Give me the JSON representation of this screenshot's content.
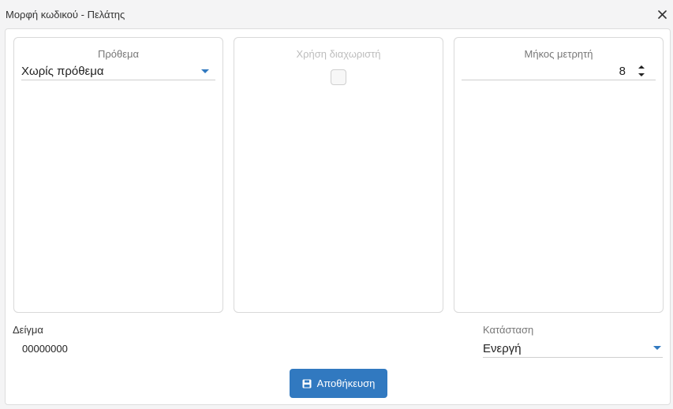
{
  "window": {
    "title": "Μορφή κωδικού - Πελάτης",
    "close_icon": "close-icon"
  },
  "prefix": {
    "label": "Πρόθεμα",
    "value": "Χωρίς πρόθεμα",
    "icon": "chevron-down-icon"
  },
  "separator": {
    "label": "Χρήση διαχωριστή",
    "checked": false,
    "disabled": true
  },
  "counter_length": {
    "label": "Μήκος μετρητή",
    "value": "8",
    "icon": "spinner-icon"
  },
  "sample": {
    "label": "Δείγμα",
    "value": "00000000"
  },
  "status": {
    "label": "Κατάσταση",
    "value": "Ενεργή",
    "icon": "chevron-down-icon"
  },
  "save_button": {
    "label": "Αποθήκευση",
    "icon": "save-icon"
  },
  "colors": {
    "accent": "#3179c0",
    "background": "#f4f4f5",
    "panel_border": "#d9d9d9"
  }
}
